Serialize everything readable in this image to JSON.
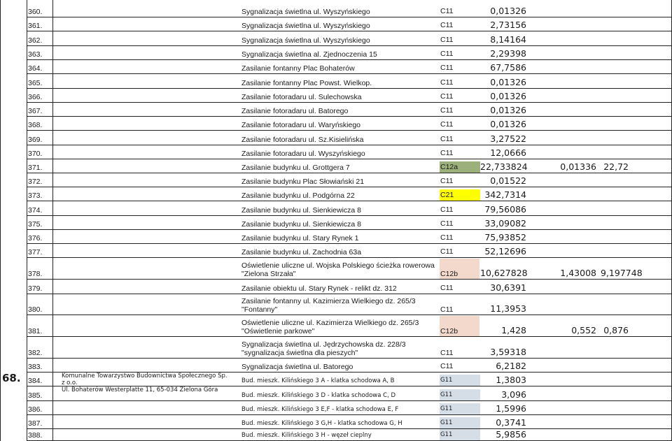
{
  "group": {
    "number": "68.",
    "owner_line1": "Komunalne Towarzystwo Budownictwa Społecznego Sp. z o.o.",
    "owner_line2": "Ul. Bohaterów Westerplatte 11, 65-034 Zielona Góra"
  },
  "colors": {
    "green": "#9bb07a",
    "yellow": "#ffff00",
    "pink": "#f3d8cc",
    "blue": "#d5dde7"
  },
  "rows": [
    {
      "num": "360.",
      "name": "Sygnalizacja świetlna ul. Wyszyńskiego",
      "tariff": "C11",
      "value": "0,01326"
    },
    {
      "num": "361.",
      "name": "Sygnalizacja świetlna ul. Wyszyńskiego",
      "tariff": "C11",
      "value": "2,73156"
    },
    {
      "num": "362.",
      "name": "Sygnalizacja świetlna ul. Wyszyńskiego",
      "tariff": "C11",
      "value": "8,14164"
    },
    {
      "num": "363.",
      "name": "Sygnalizacja świetlna al. Zjednoczenia 15",
      "tariff": "C11",
      "value": "2,29398"
    },
    {
      "num": "364.",
      "name": "Zasilanie fontanny Plac Bohaterów",
      "tariff": "C11",
      "value": "67,7586"
    },
    {
      "num": "365.",
      "name": "Zasilanie fontanny Plac Powst. Wielkop.",
      "tariff": "C11",
      "value": "0,01326"
    },
    {
      "num": "366.",
      "name": "Zasilanie fotoradaru ul. Sulechowska",
      "tariff": "C11",
      "value": "0,01326"
    },
    {
      "num": "367.",
      "name": "Zasilanie fotoradaru ul. Batorego",
      "tariff": "C11",
      "value": "0,01326"
    },
    {
      "num": "368.",
      "name": "Zasilanie fotoradaru ul. Waryńskiego",
      "tariff": "C11",
      "value": "0,01326"
    },
    {
      "num": "369.",
      "name": "Zasilanie fotoradaru ul. Sz.Kisielińska",
      "tariff": "C11",
      "value": "3,27522"
    },
    {
      "num": "370.",
      "name": "Zasilanie fotoradaru ul. Wyszyńskiego",
      "tariff": "C11",
      "value": "12,0666"
    },
    {
      "num": "371.",
      "name": "Zasilanie budynku ul. Grottgera 7",
      "tariff": "C12a",
      "value": "22,733824",
      "value2": "0,01336",
      "value3": "22,72"
    },
    {
      "num": "372.",
      "name": "Zasilanie budynku Plac Słowiański 21",
      "tariff": "C11",
      "value": "0,01522"
    },
    {
      "num": "373.",
      "name": "Zasilanie budynku ul. Podgórna 22",
      "tariff": "C21",
      "value": "342,7314"
    },
    {
      "num": "374.",
      "name": "Zasilanie budynku ul. Sienkiewicza 8",
      "tariff": "C11",
      "value": "79,56086"
    },
    {
      "num": "375.",
      "name": "Zasilanie budynku ul. Sienkiewicza 8",
      "tariff": "C11",
      "value": "33,09082"
    },
    {
      "num": "376.",
      "name": "Zasilanie budynku ul. Stary Rynek 1",
      "tariff": "C11",
      "value": "75,93852"
    },
    {
      "num": "377.",
      "name": "Zasilanie budynku ul. Zachodnia 63a",
      "tariff": "C11",
      "value": "52,12696"
    },
    {
      "num": "378.",
      "name": "Oświetlenie uliczne ul. Wojska Polskiego ścieżka rowerowa \"Zielona Strzała\"",
      "tariff": "C12b",
      "value": "10,627828",
      "value2": "1,43008",
      "value3": "9,197748"
    },
    {
      "num": "379.",
      "name": "Zasilanie obiektu ul. Stary Rynek - relikt dz. 312",
      "tariff": "C11",
      "value": "30,6391"
    },
    {
      "num": "380.",
      "name": "Zasilanie fontanny ul. Kazimierza Wielkiego dz. 265/3 \"Fontanny\"",
      "tariff": "C11",
      "value": "11,3953"
    },
    {
      "num": "381.",
      "name": "Oświetlenie uliczne ul. Kazimierza Wielkiego dz. 265/3 \"Oświetlenie parkowe\"",
      "tariff": "C12b",
      "value": "1,428",
      "value2": "0,552",
      "value3": "0,876"
    },
    {
      "num": "382.",
      "name": "Sygnalizacja świetlna ul. Jędrzychowska dz. 228/3 \"sygnalizacja świetlna dla pieszych\"",
      "tariff": "C11",
      "value": "3,59318"
    },
    {
      "num": "383.",
      "name": "Sygnalizacja świetlna ul. Batorego",
      "tariff": "C11",
      "value": "6,2182"
    },
    {
      "num": "384.",
      "name": "Bud. mieszk. Kilińskiego 3 A - klatka schodowa A, B",
      "tariff": "G11",
      "value": "1,3803"
    },
    {
      "num": "385.",
      "name": "Bud. mieszk. Kilińskiego 3 D - klatka schodowa C, D",
      "tariff": "G11",
      "value": "3,096"
    },
    {
      "num": "386.",
      "name": "Bud. mieszk. Kilińskiego 3 E,F - klatka schodowa E, F",
      "tariff": "G11",
      "value": "1,5996"
    },
    {
      "num": "387.",
      "name": "Bud. mieszk. Kilińskiego 3 G,H - klatka schodowa G, H",
      "tariff": "G11",
      "value": "0,3741"
    },
    {
      "num": "388.",
      "name": "Bud. mieszk. Kilińskiego 3 H - węzeł cieplny",
      "tariff": "G11",
      "value": "5,9856"
    }
  ]
}
